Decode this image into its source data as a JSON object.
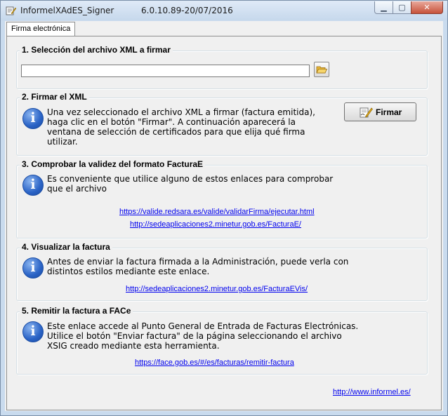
{
  "window": {
    "title": "InformelXAdES_Signer",
    "version": "6.0.10.89-20/07/2016",
    "controls": {
      "minimize": "▁",
      "maximize": "▢",
      "close": "✕"
    }
  },
  "tab": {
    "label": "Firma electrónica"
  },
  "section1": {
    "title": "1. Selección del archivo XML a firmar",
    "file_value": ""
  },
  "section2": {
    "title": "2. Firmar el XML",
    "text": "Una vez seleccionado el archivo XML a firmar (factura emitida), haga clic en el botón \"Firmar\". A continuación aparecerá la ventana de selección de certificados para que elija qué firma utilizar.",
    "button_label": "Firmar"
  },
  "section3": {
    "title": "3. Comprobar la validez del formato FacturaE",
    "text": "Es conveniente que utilice alguno de estos enlaces para comprobar que el archivo",
    "link1": "https://valide.redsara.es/valide/validarFirma/ejecutar.html",
    "link2": "http://sedeaplicaciones2.minetur.gob.es/FacturaE/"
  },
  "section4": {
    "title": "4. Visualizar la factura",
    "text": "Antes de enviar la factura firmada a la Administración, puede verla con distintos estilos mediante este enlace.",
    "link": "http://sedeaplicaciones2.minetur.gob.es/FacturaEVis/"
  },
  "section5": {
    "title": "5. Remitir la factura a FACe",
    "text": "Este enlace accede al Punto General de Entrada de Facturas Electrónicas. Utilice el botón \"Enviar factura\" de la página seleccionando el archivo XSIG creado mediante esta herramienta.",
    "link": "https://face.gob.es/#/es/facturas/remitir-factura"
  },
  "footer": {
    "link": "http://www.informel.es/"
  },
  "icons": {
    "info": "info-icon",
    "folder": "folder-open-icon",
    "sign": "signature-pen-icon",
    "app": "app-icon"
  },
  "colors": {
    "link": "#0000ee",
    "panel": "#f0f0f0",
    "info_blue": "#2a63c6"
  }
}
